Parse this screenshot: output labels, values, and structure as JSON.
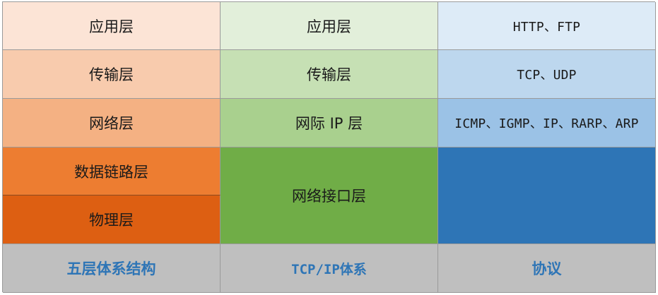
{
  "five_layer": {
    "application": "应用层",
    "transport": "传输层",
    "network": "网络层",
    "data_link": "数据链路层",
    "physical": "物理层",
    "footer": "五层体系结构"
  },
  "tcpip": {
    "application": "应用层",
    "transport": "传输层",
    "internet": "网际 IP 层",
    "network_interface": "网络接口层",
    "footer": "TCP/IP体系"
  },
  "protocols": {
    "application": "HTTP、FTP",
    "transport": "TCP、UDP",
    "network": "ICMP、IGMP、IP、RARP、ARP",
    "link": "",
    "footer": "协议"
  },
  "colors": {
    "five_layer": [
      "#fce4d6",
      "#f8cbad",
      "#f4b183",
      "#ed7d31",
      "#dd5f12"
    ],
    "tcpip": [
      "#e2efda",
      "#c6e0b4",
      "#a9d08e",
      "#70ad47"
    ],
    "protocols": [
      "#ddebf7",
      "#bdd7ee",
      "#9bc2e6",
      "#2e75b6"
    ],
    "footer_background": "#bfbfbf",
    "footer_text": "#2e75b6"
  }
}
